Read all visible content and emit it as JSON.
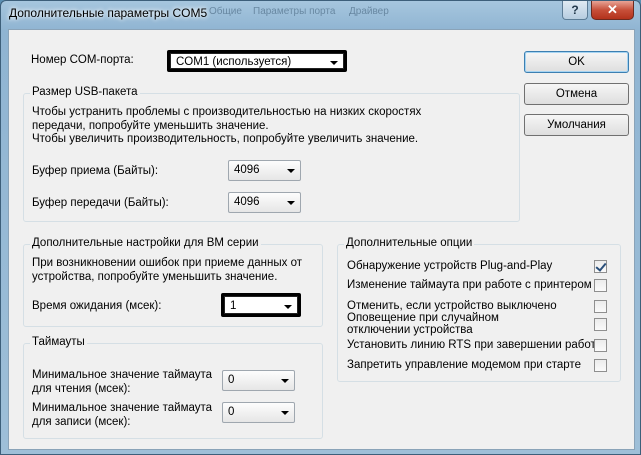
{
  "window": {
    "title": "Дополнительные параметры COM5",
    "background_tabs": [
      "Общие",
      "Параметры порта",
      "Драйвер"
    ],
    "help_glyph": "?",
    "close_glyph": "✕"
  },
  "com_port": {
    "label": "Номер COM-порта:",
    "value": "COM1 (используется)"
  },
  "usb_group": {
    "title": "Размер USB-пакета",
    "desc1": "Чтобы устранить проблемы с производительностью на низких скоростях передачи, попробуйте уменьшить значение.",
    "desc2": "Чтобы увеличить производительность, попробуйте увеличить значение.",
    "rx_label": "Буфер приема (Байты):",
    "rx_value": "4096",
    "tx_label": "Буфер передачи (Байты):",
    "tx_value": "4096"
  },
  "bm_group": {
    "title": "Дополнительные настройки для BM серии",
    "desc": "При возникновении ошибок при приеме данных от устройства, попробуйте уменьшить значение.",
    "latency_label": "Время ожидания (мсек):",
    "latency_value": "1"
  },
  "timeouts_group": {
    "title": "Таймауты",
    "read_label": "Минимальное значение таймаута для чтения (мсек):",
    "read_value": "0",
    "write_label": "Минимальное значение таймаута для записи (мсек):",
    "write_value": "0"
  },
  "options_group": {
    "title": "Дополнительные опции",
    "items": [
      {
        "label": "Обнаружение устройств Plug-and-Play",
        "checked": true
      },
      {
        "label": "Изменение таймаута при работе с принтером",
        "checked": false
      },
      {
        "label": "Отменить, если устройство выключено",
        "checked": false
      },
      {
        "label": "Оповещение при случайном отключении устройства",
        "checked": false
      },
      {
        "label": "Установить линию RTS при завершении работы",
        "checked": false
      },
      {
        "label": "Запретить управление модемом при старте",
        "checked": false
      }
    ]
  },
  "buttons": {
    "ok": "OK",
    "cancel": "Отмена",
    "defaults": "Умолчания"
  }
}
